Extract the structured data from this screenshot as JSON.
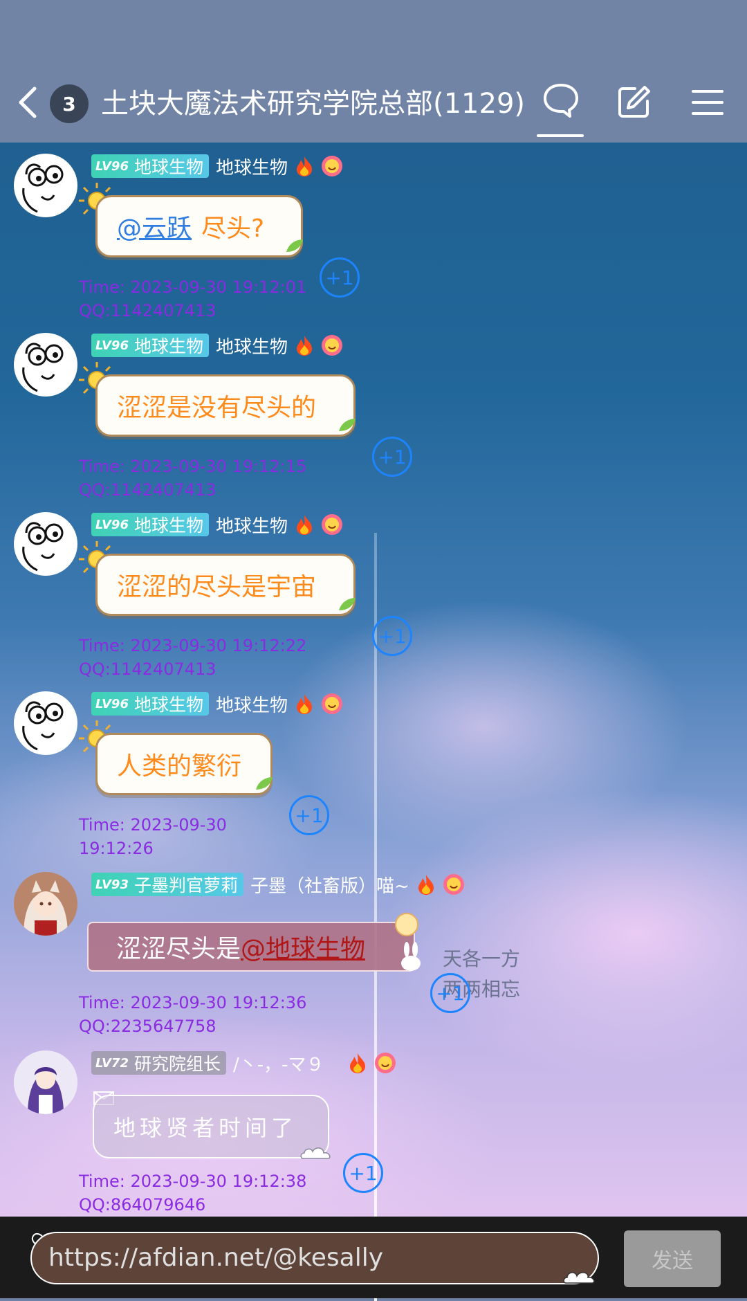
{
  "header": {
    "unread_count": "3",
    "title": "土块大魔法术研究学院总部(1129)"
  },
  "messages": [
    {
      "level": "LV96",
      "title_tag": "地球生物",
      "nickname": "地球生物",
      "mention": "@云跃",
      "text": "尽头?",
      "plus_one": "+1",
      "time": "Time: 2023-09-30 19:12:01",
      "qq": "QQ:1142407413"
    },
    {
      "level": "LV96",
      "title_tag": "地球生物",
      "nickname": "地球生物",
      "text": "涩涩是没有尽头的",
      "plus_one": "+1",
      "time": "Time: 2023-09-30 19:12:15",
      "qq": "QQ:1142407413"
    },
    {
      "level": "LV96",
      "title_tag": "地球生物",
      "nickname": "地球生物",
      "text": "涩涩的尽头是宇宙",
      "plus_one": "+1",
      "time": "Time: 2023-09-30 19:12:22",
      "qq": "QQ:1142407413"
    },
    {
      "level": "LV96",
      "title_tag": "地球生物",
      "nickname": "地球生物",
      "text": "人类的繁衍",
      "plus_one": "+1",
      "time_line1": "Time: 2023-09-30",
      "time_line2": "19:12:26"
    },
    {
      "level": "LV93",
      "title_tag": "子墨判官萝莉",
      "nickname": "子墨（社畜版）喵~",
      "text": "涩涩尽头是",
      "mention": "@地球生物",
      "plus_one": "+1",
      "time": "Time: 2023-09-30 19:12:36",
      "qq": "QQ:2235647758",
      "decoration_line1": "天各一方",
      "decoration_line2": "两两相忘"
    },
    {
      "level": "LV72",
      "title_tag": "研究院组长",
      "nickname": "/丶-，-マ９",
      "text": "地球贤者时间了",
      "plus_one": "+1",
      "time": "Time: 2023-09-30 19:12:38",
      "qq": "QQ:864079646"
    }
  ],
  "input": {
    "value": "https://afdian.net/@kesally"
  },
  "send": {
    "label": "发送"
  },
  "colors": {
    "meta_purple": "#8a2be2",
    "plus_one_blue": "#1d84ff",
    "bubble_orange": "#ff8a1c"
  }
}
